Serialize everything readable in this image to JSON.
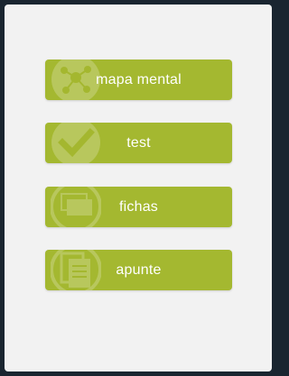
{
  "colors": {
    "frame": "#1a2530",
    "background": "#f2f2f2",
    "button": "#a4b830",
    "button_text": "#ffffff"
  },
  "menu": {
    "items": [
      {
        "label": "mapa mental",
        "icon": "mind-map-icon"
      },
      {
        "label": "test",
        "icon": "checkmark-icon"
      },
      {
        "label": "fichas",
        "icon": "flashcards-icon"
      },
      {
        "label": "apunte",
        "icon": "notes-icon"
      }
    ]
  }
}
